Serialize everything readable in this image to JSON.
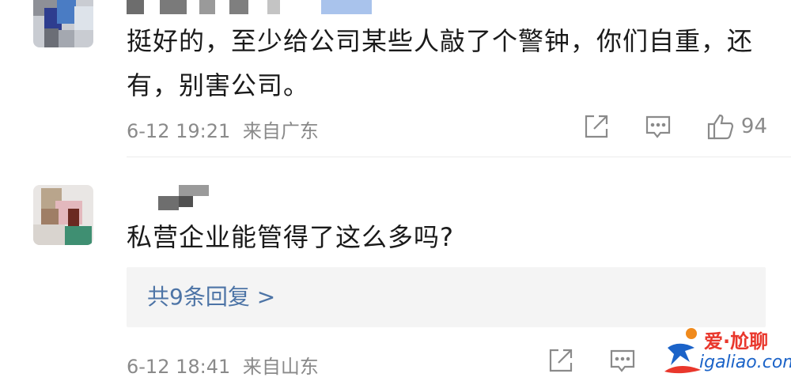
{
  "comments": [
    {
      "text": "挺好的，至少给公司某些人敲了个警钟，你们自重，还有，别害公司。",
      "date": "6-12 19:21",
      "location": "来自广东",
      "likes": "94"
    },
    {
      "text": "私营企业能管得了这么多吗?",
      "date": "6-12 18:41",
      "location": "来自山东",
      "reply_label": "共9条回复 >"
    }
  ],
  "watermark": {
    "top_text": "爱·尬聊",
    "bottom_text": "igaliao.com"
  },
  "icons": {
    "share": "share-icon",
    "comment": "comment-icon",
    "like": "like-icon"
  },
  "colors": {
    "reply_link": "#4d74a6",
    "meta_text": "#8a8a8a",
    "watermark_red": "#e9372c",
    "watermark_blue": "#1b63c8"
  }
}
